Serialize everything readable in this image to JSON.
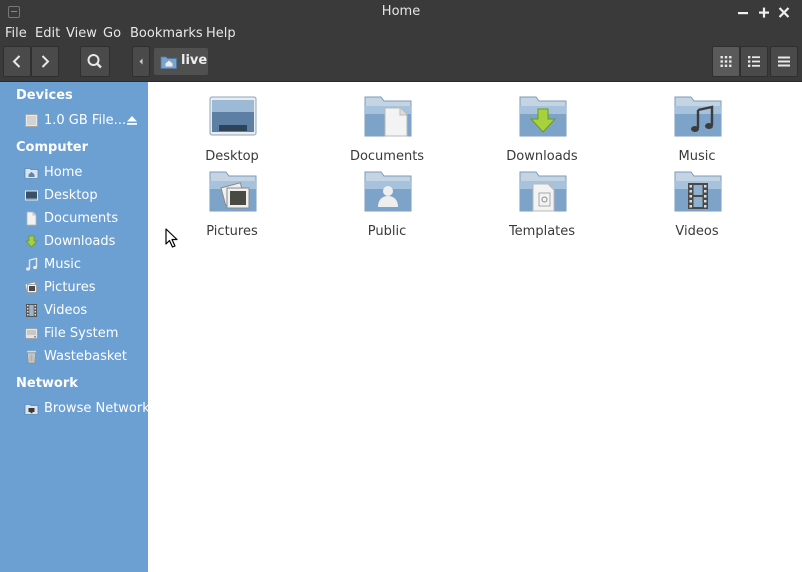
{
  "window": {
    "title": "Home"
  },
  "menubar": {
    "items": [
      "File",
      "Edit",
      "View",
      "Go",
      "Bookmarks",
      "Help"
    ]
  },
  "toolbar": {
    "breadcrumb": "live"
  },
  "sidebar": {
    "devices_header": "Devices",
    "devices": [
      {
        "label": "1.0 GB File...",
        "icon": "drive-icon"
      }
    ],
    "computer_header": "Computer",
    "computer": [
      {
        "label": "Home",
        "icon": "home-icon"
      },
      {
        "label": "Desktop",
        "icon": "desktop-icon"
      },
      {
        "label": "Documents",
        "icon": "documents-icon"
      },
      {
        "label": "Downloads",
        "icon": "downloads-icon"
      },
      {
        "label": "Music",
        "icon": "music-icon"
      },
      {
        "label": "Pictures",
        "icon": "pictures-icon"
      },
      {
        "label": "Videos",
        "icon": "videos-icon"
      },
      {
        "label": "File System",
        "icon": "filesystem-icon"
      },
      {
        "label": "Wastebasket",
        "icon": "trash-icon"
      }
    ],
    "network_header": "Network",
    "network": [
      {
        "label": "Browse Network",
        "icon": "network-icon"
      }
    ]
  },
  "files": [
    {
      "label": "Desktop",
      "icon": "desktop-folder-icon"
    },
    {
      "label": "Documents",
      "icon": "documents-folder-icon"
    },
    {
      "label": "Downloads",
      "icon": "downloads-folder-icon"
    },
    {
      "label": "Music",
      "icon": "music-folder-icon"
    },
    {
      "label": "Pictures",
      "icon": "pictures-folder-icon"
    },
    {
      "label": "Public",
      "icon": "public-folder-icon"
    },
    {
      "label": "Templates",
      "icon": "templates-folder-icon"
    },
    {
      "label": "Videos",
      "icon": "videos-folder-icon"
    }
  ],
  "colors": {
    "sidebar_bg": "#6c9fd2",
    "chrome_bg": "#3a3a3a",
    "folder_blue": "#7da3c9"
  }
}
